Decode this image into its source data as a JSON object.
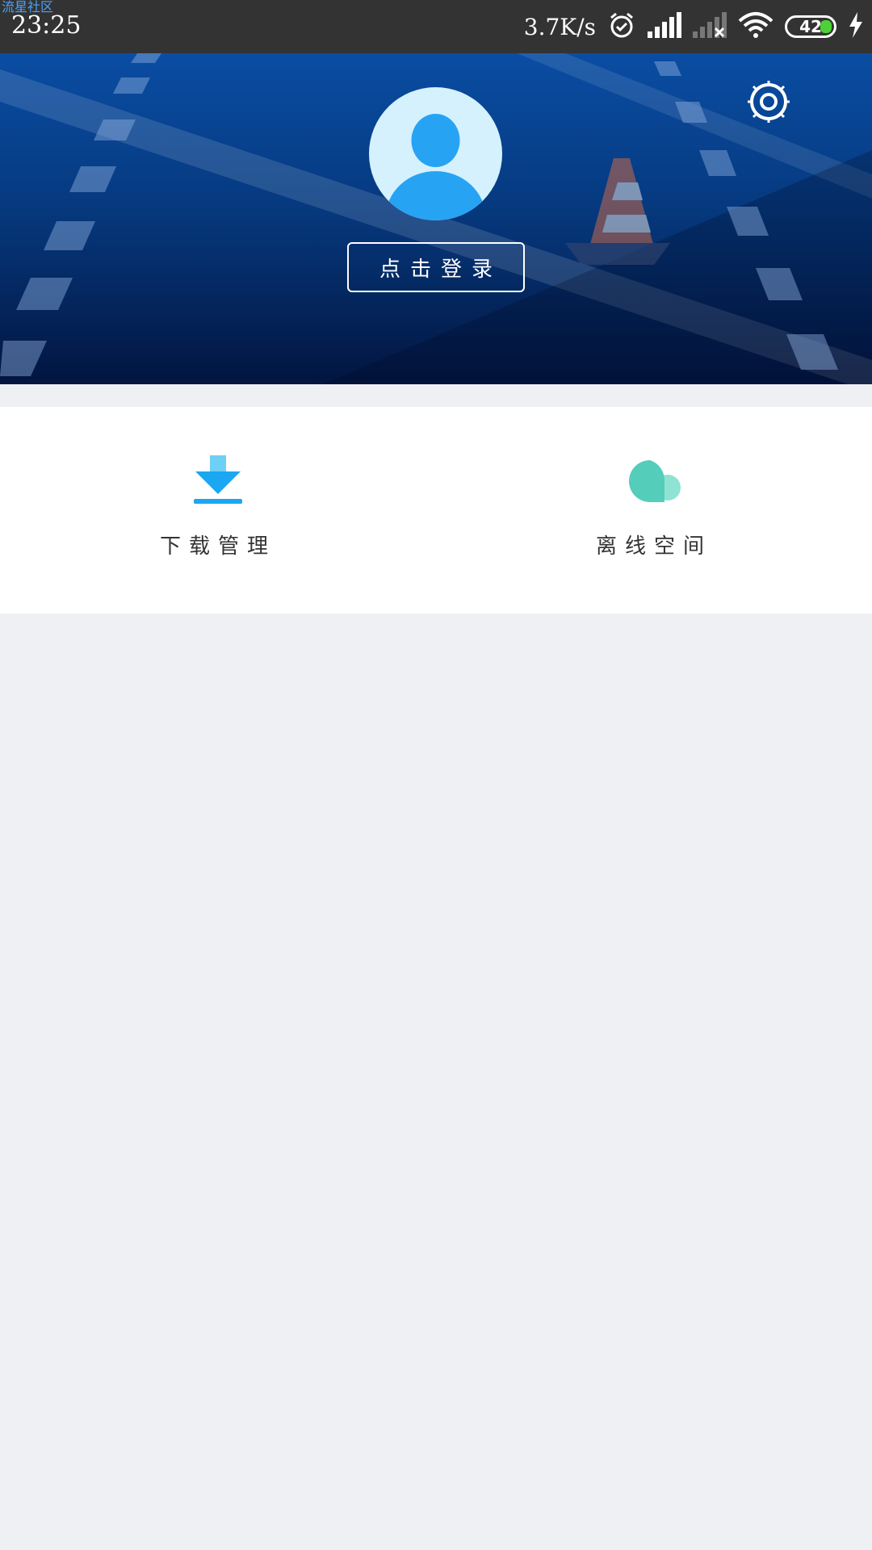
{
  "status_bar": {
    "watermark": "流星社区",
    "time": "23:25",
    "net_speed": "3.7K/s",
    "battery": "42",
    "icons": [
      "alarm-icon",
      "signal-icon",
      "signal-nosim-icon",
      "wifi-icon",
      "battery-icon",
      "charging-icon"
    ]
  },
  "header": {
    "login_label": "点击登录",
    "icons": [
      "settings-icon",
      "avatar-icon"
    ]
  },
  "menu": {
    "items": [
      {
        "label": "下载管理",
        "icon": "download-icon",
        "color": "#1aa8f2"
      },
      {
        "label": "离线空间",
        "icon": "cloud-icon",
        "color": "#55cdbb"
      }
    ]
  },
  "colors": {
    "status_bg": "#333333",
    "hero_top": "#0a4da3",
    "hero_bottom": "#021540",
    "page_bg": "#eff0f3",
    "accent": "#1aa8f2"
  }
}
